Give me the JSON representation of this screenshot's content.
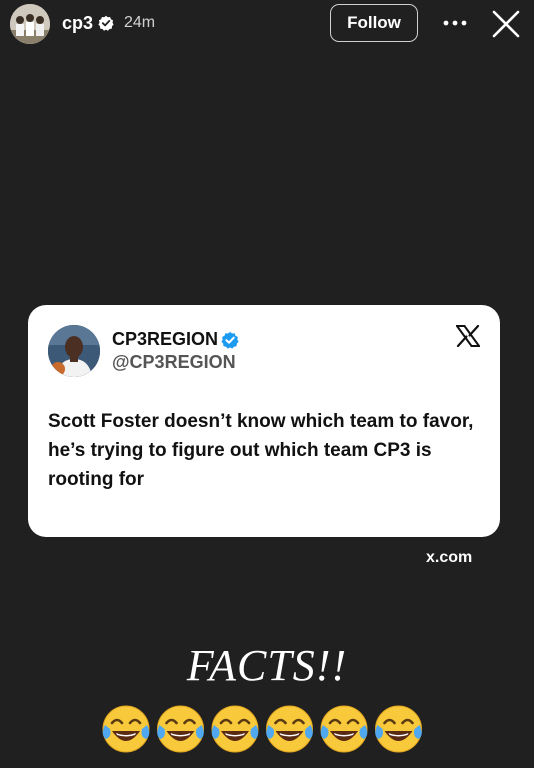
{
  "header": {
    "username": "cp3",
    "time": "24m",
    "follow_label": "Follow",
    "icons": [
      "avatar",
      "verified-badge-icon",
      "more-options-icon",
      "close-icon"
    ]
  },
  "tweet": {
    "name": "CP3REGION",
    "handle": "@CP3REGION",
    "text": "Scott Foster doesn’t know which team to favor, he’s trying to figure out which team CP3 is rooting for",
    "icons": [
      "verified-badge-icon",
      "x-logo-icon"
    ],
    "verified_color": "#1d9bf0"
  },
  "source_label": "x.com",
  "caption": "FACTS!!",
  "emoji": {
    "name": "face-with-tears-of-joy",
    "count": 6
  },
  "colors": {
    "background": "#202020",
    "card": "#ffffff",
    "text_light": "#ffffff"
  }
}
